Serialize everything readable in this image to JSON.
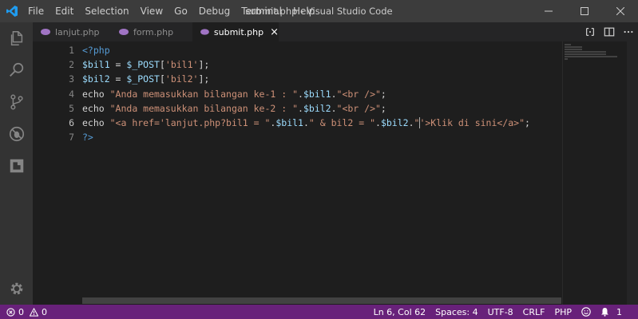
{
  "window": {
    "title": "submit.php - Visual Studio Code",
    "menu": [
      "File",
      "Edit",
      "Selection",
      "View",
      "Go",
      "Debug",
      "Terminal",
      "Help"
    ]
  },
  "tabs": [
    {
      "label": "lanjut.php",
      "icon": "php-file-icon",
      "active": false
    },
    {
      "label": "form.php",
      "icon": "php-file-icon",
      "active": false
    },
    {
      "label": "submit.php",
      "icon": "php-file-icon",
      "active": true,
      "close": "×"
    }
  ],
  "editor": {
    "line_numbers": [
      "1",
      "2",
      "3",
      "4",
      "5",
      "6",
      "7"
    ],
    "current_line": "6",
    "lines": [
      [
        {
          "t": "<?php",
          "c": "php"
        }
      ],
      [
        {
          "t": "$bil1",
          "c": "var"
        },
        {
          "t": " = ",
          "c": "plain"
        },
        {
          "t": "$_POST",
          "c": "var"
        },
        {
          "t": "[",
          "c": "plain"
        },
        {
          "t": "'bil1'",
          "c": "str"
        },
        {
          "t": "];",
          "c": "plain"
        }
      ],
      [
        {
          "t": "$bil2",
          "c": "var"
        },
        {
          "t": " = ",
          "c": "plain"
        },
        {
          "t": "$_POST",
          "c": "var"
        },
        {
          "t": "[",
          "c": "plain"
        },
        {
          "t": "'bil2'",
          "c": "str"
        },
        {
          "t": "];",
          "c": "plain"
        }
      ],
      [
        {
          "t": "echo ",
          "c": "plain"
        },
        {
          "t": "\"Anda memasukkan bilangan ke-1 : \"",
          "c": "str"
        },
        {
          "t": ".",
          "c": "plain"
        },
        {
          "t": "$bil1",
          "c": "var"
        },
        {
          "t": ".",
          "c": "plain"
        },
        {
          "t": "\"<br />\"",
          "c": "str"
        },
        {
          "t": ";",
          "c": "plain"
        }
      ],
      [
        {
          "t": "echo ",
          "c": "plain"
        },
        {
          "t": "\"Anda memasukkan bilangan ke-2 : \"",
          "c": "str"
        },
        {
          "t": ".",
          "c": "plain"
        },
        {
          "t": "$bil2",
          "c": "var"
        },
        {
          "t": ".",
          "c": "plain"
        },
        {
          "t": "\"<br />\"",
          "c": "str"
        },
        {
          "t": ";",
          "c": "plain"
        }
      ],
      [
        {
          "t": "echo ",
          "c": "plain"
        },
        {
          "t": "\"<a href='lanjut.php?bil1 = \"",
          "c": "str"
        },
        {
          "t": ".",
          "c": "plain"
        },
        {
          "t": "$bil1",
          "c": "var"
        },
        {
          "t": ".",
          "c": "plain"
        },
        {
          "t": "\" & bil2 = \"",
          "c": "str"
        },
        {
          "t": ".",
          "c": "plain"
        },
        {
          "t": "$bil2",
          "c": "var"
        },
        {
          "t": ".",
          "c": "plain"
        },
        {
          "t": "\"",
          "c": "str"
        },
        {
          "t": "CURSOR",
          "c": "cursor"
        },
        {
          "t": "'>Klik di sini</a>\"",
          "c": "str"
        },
        {
          "t": ";",
          "c": "plain"
        }
      ],
      [
        {
          "t": "?>",
          "c": "php"
        }
      ]
    ]
  },
  "statusbar": {
    "errors": "0",
    "warnings": "0",
    "position": "Ln 6, Col 62",
    "spaces": "Spaces: 4",
    "encoding": "UTF-8",
    "eol": "CRLF",
    "language": "PHP",
    "notifications": "1"
  },
  "colors": {
    "statusbar": "#68217a",
    "activitybar": "#333333",
    "titlebar": "#3c3c3c",
    "editor": "#1e1e1e",
    "php_tag": "#569cd6",
    "variable": "#9cdcfe",
    "string": "#ce9178",
    "php_icon": "#a074c4"
  }
}
